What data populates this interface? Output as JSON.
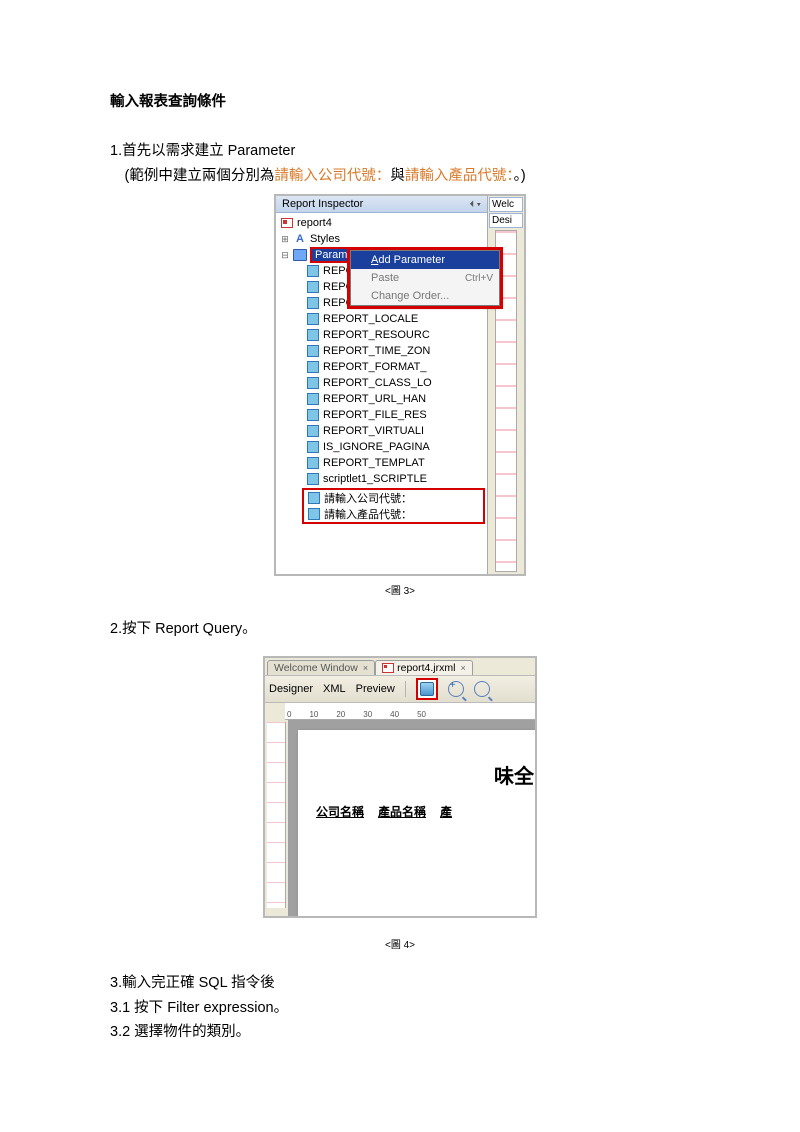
{
  "heading": "輸入報表查詢條件",
  "step1_line1": "1.首先以需求建立 Parameter",
  "step1_line2_a": "(範例中建立兩個分別為",
  "step1_line2_b": "請輸入公司代號：",
  "step1_line2_c": "與",
  "step1_line2_d": "請輸入產品代號：",
  "step1_line2_e": "。)",
  "fig3": {
    "title": "Report Inspector",
    "root": "report4",
    "styles": "Styles",
    "parameters": "Parameters",
    "ctx": {
      "add": "Add Parameter",
      "paste": "Paste",
      "paste_sc": "Ctrl+V",
      "change": "Change Order..."
    },
    "params": [
      "REPORT_MAX_COU",
      "REPORT_DATA_SO",
      "REPORT_SCRIPTLE",
      "REPORT_LOCALE",
      "REPORT_RESOURC",
      "REPORT_TIME_ZON",
      "REPORT_FORMAT_",
      "REPORT_CLASS_LO",
      "REPORT_URL_HAN",
      "REPORT_FILE_RES",
      "REPORT_VIRTUALI",
      "IS_IGNORE_PAGINA",
      "REPORT_TEMPLAT",
      "scriptlet1_SCRIPTLE"
    ],
    "custom": [
      "請輸入公司代號：",
      "請輸入產品代號："
    ],
    "right_tab1": "Welc",
    "right_tab2": "Desi"
  },
  "caption3": "<圖 3>",
  "step2": "2.按下 Report Query。",
  "fig4": {
    "tab1": "Welcome Window",
    "tab2": "report4.jrxml",
    "tb": {
      "designer": "Designer",
      "xml": "XML",
      "preview": "Preview"
    },
    "ruler_ticks": [
      "0",
      "10",
      "20",
      "30",
      "40",
      "50"
    ],
    "title_text": "味全",
    "col1": "公司名稱",
    "col2": "產品名稱",
    "col3": "產"
  },
  "caption4": "<圖 4>",
  "step3": "3.輸入完正確 SQL 指令後",
  "step3_1": "3.1 按下 Filter expression。",
  "step3_2": "3.2 選擇物件的類別。"
}
